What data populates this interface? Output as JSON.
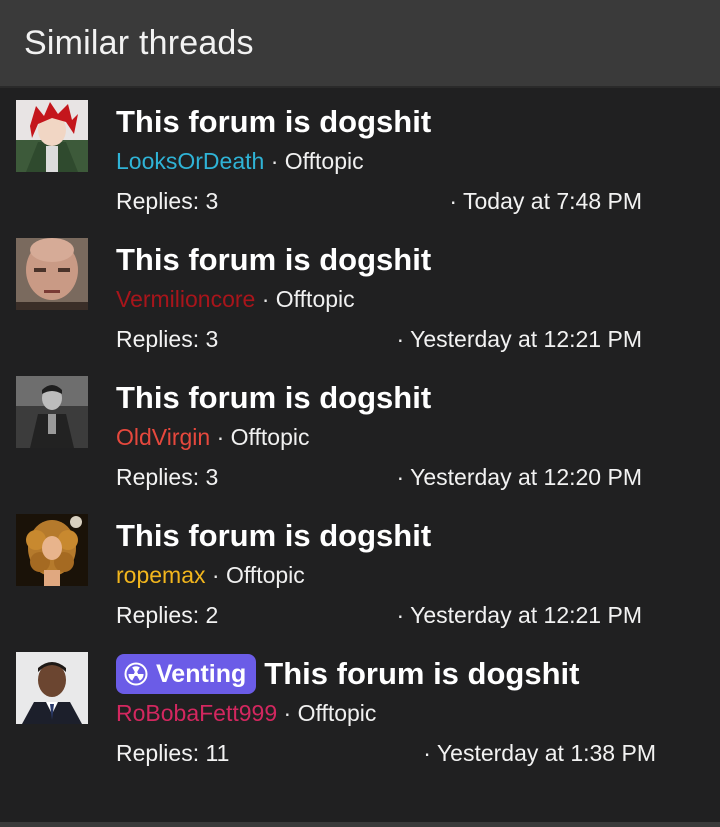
{
  "header": {
    "title": "Similar threads"
  },
  "threads": [
    {
      "title": "This forum is dogshit",
      "prefix": "",
      "author": "LooksOrDeath",
      "author_color": "#2fb3d6",
      "separator": "·",
      "forum": "Offtopic",
      "replies": "Replies: 3",
      "date": "· Today at 7:48 PM",
      "avatar_icon": "avatar-anime-red-hair"
    },
    {
      "title": "This forum is dogshit",
      "prefix": "",
      "author": "Vermilioncore",
      "author_color": "#a8151b",
      "separator": "·",
      "forum": "Offtopic",
      "replies": "Replies: 3",
      "date": "· Yesterday at 12:21 PM",
      "avatar_icon": "avatar-bald-man"
    },
    {
      "title": "This forum is dogshit",
      "prefix": "",
      "author": "OldVirgin",
      "author_color": "#e6483d",
      "separator": "·",
      "forum": "Offtopic",
      "replies": "Replies: 3",
      "date": "· Yesterday at 12:20 PM",
      "avatar_icon": "avatar-grayscale-man"
    },
    {
      "title": "This forum is dogshit",
      "prefix": "",
      "author": "ropemax",
      "author_color": "#f2b61d",
      "separator": "·",
      "forum": "Offtopic",
      "replies": "Replies: 2",
      "date": "· Yesterday at 12:21 PM",
      "avatar_icon": "avatar-curly-hair-singer"
    },
    {
      "title": "This forum is dogshit",
      "prefix": "Venting",
      "prefix_color": "#6b5ce7",
      "author": "RoBobaFett999",
      "author_color": "#d3275f",
      "separator": "·",
      "forum": "Offtopic",
      "replies": "Replies: 11",
      "date": "· Yesterday at 1:38 PM",
      "avatar_icon": "avatar-man-in-suit"
    }
  ]
}
